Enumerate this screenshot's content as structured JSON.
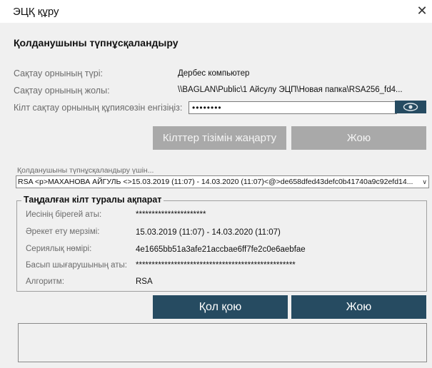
{
  "window": {
    "title": "ЭЦҚ құру",
    "close_glyph": "✕"
  },
  "section": {
    "title": "Қолданушыны түпнұсқаландыру"
  },
  "fields": {
    "storage_type_label": "Сақтау орнының түрі:",
    "storage_type_value": "Дербес компьютер",
    "storage_path_label": "Сақтау орнының жолы:",
    "storage_path_value": "\\\\BAGLAN\\Public\\1 Айсулу ЭЦП\\Новая папка\\RSA256_fd4...",
    "password_label": "Кілт сақтау орнының құпиясөзін енгізіңіз:",
    "password_value": "••••••••"
  },
  "buttons": {
    "refresh_keys": "Кілттер тізімін жаңарту",
    "delete_top": "Жою",
    "sign": "Қол қою",
    "delete_bottom": "Жою"
  },
  "key_select": {
    "hint": "Қолданушыны түпнұсқаландыру үшін...",
    "selected": "RSA <p>МАХАНОВА АЙГУЛЬ <>15.03.2019 (11:07) - 14.03.2020 (11:07)<@>de658dfed43defc0b41740a9c92efd14...",
    "arrow": "∨"
  },
  "key_info": {
    "title": "Таңдалған кілт туралы ақпарат",
    "owner_label": "Иесінің бірегей аты:",
    "owner_value": "**********************",
    "validity_label": "Әрекет ету мерзімі:",
    "validity_value": "15.03.2019 (11:07) - 14.03.2020 (11:07)",
    "serial_label": "Сериялық нөмірі:",
    "serial_value": "4e1665bb51a3afe21accbae6ff7fe2c0e6aebfae",
    "issuer_label": "Басып шығарушының аты:",
    "issuer_value": "**************************************************",
    "algorithm_label": "Алгоритм:",
    "algorithm_value": "RSA"
  },
  "colors": {
    "accent": "#264b61",
    "disabled": "#a9a9a9",
    "background": "#f0f0f0"
  }
}
